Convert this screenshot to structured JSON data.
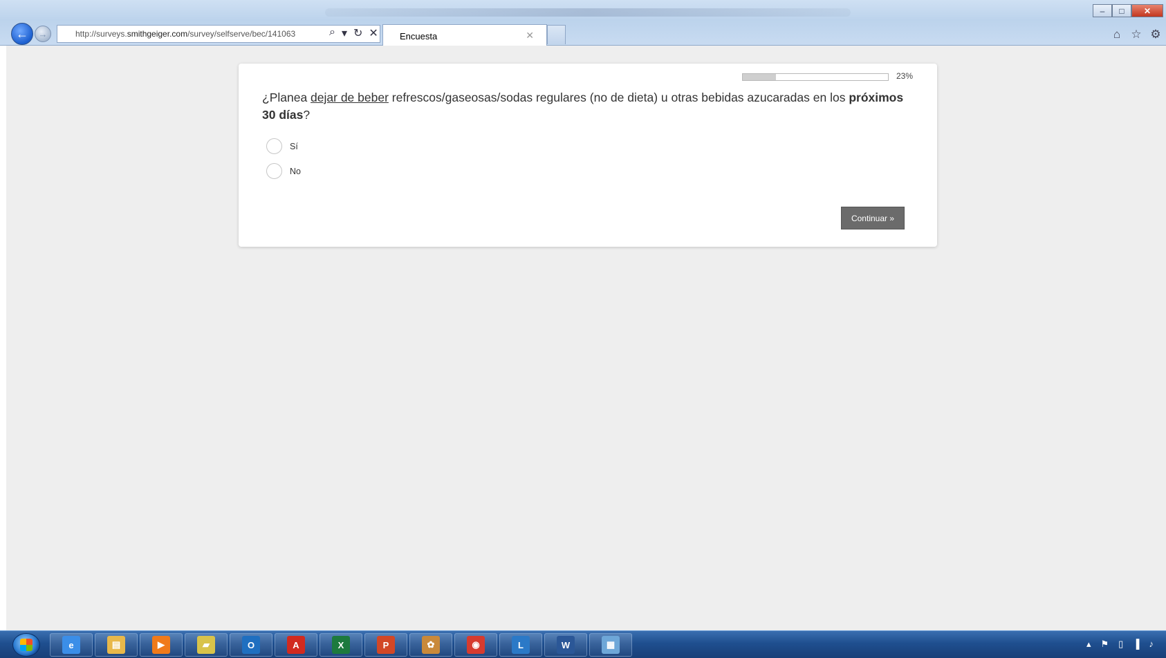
{
  "browser": {
    "url_prefix": "http://surveys.",
    "url_domain": "smithgeiger.com",
    "url_path": "/survey/selfserve/bec/141063",
    "tab_title": "Encuesta",
    "icons": [
      "back-arrow-icon",
      "forward-arrow-icon",
      "search-icon",
      "dropdown-icon",
      "refresh-icon",
      "stop-icon",
      "tab-close-icon",
      "home-icon",
      "favorites-star-icon",
      "settings-gear-icon",
      "minimize-icon",
      "maximize-icon",
      "window-close-icon"
    ]
  },
  "survey": {
    "progress_percent": 23,
    "progress_label": "23%",
    "question_part1": "¿Planea ",
    "question_underlined": "dejar de beber",
    "question_part2": " refrescos/gaseosas/sodas regulares (no de dieta) u otras bebidas azucaradas en los ",
    "question_bold": "próximos 30 días",
    "question_end": "?",
    "options": [
      {
        "label": "Sí",
        "selected": false
      },
      {
        "label": "No",
        "selected": false
      }
    ],
    "continue_label": "Continuar »"
  },
  "taskbar": {
    "apps": [
      {
        "name": "internet-explorer",
        "glyph": "e",
        "color": "#3b8ee8"
      },
      {
        "name": "file-explorer",
        "glyph": "▤",
        "color": "#e8b84a"
      },
      {
        "name": "media-player",
        "glyph": "▶",
        "color": "#f07a1a"
      },
      {
        "name": "sticky-notes",
        "glyph": "▰",
        "color": "#d8c34a"
      },
      {
        "name": "outlook",
        "glyph": "O",
        "color": "#1f6fc0"
      },
      {
        "name": "adobe-reader",
        "glyph": "A",
        "color": "#d12a1f"
      },
      {
        "name": "excel",
        "glyph": "X",
        "color": "#1d7a3e"
      },
      {
        "name": "powerpoint",
        "glyph": "P",
        "color": "#d24726"
      },
      {
        "name": "paint-app",
        "glyph": "✿",
        "color": "#c9893a"
      },
      {
        "name": "chrome",
        "glyph": "◉",
        "color": "#d63b2f"
      },
      {
        "name": "lync",
        "glyph": "L",
        "color": "#2b79c7"
      },
      {
        "name": "word",
        "glyph": "W",
        "color": "#2b5797"
      },
      {
        "name": "remote-desktop",
        "glyph": "▦",
        "color": "#6ea7d8"
      }
    ],
    "tray_icons": [
      "show-hidden-icon",
      "action-center-flag-icon",
      "battery-icon",
      "signal-icon",
      "volume-icon"
    ]
  },
  "colors": {
    "page_bg": "#eeeeee",
    "card_bg": "#ffffff",
    "button_bg": "#6b6b6b",
    "progress_fill": "#cfcfcf"
  }
}
